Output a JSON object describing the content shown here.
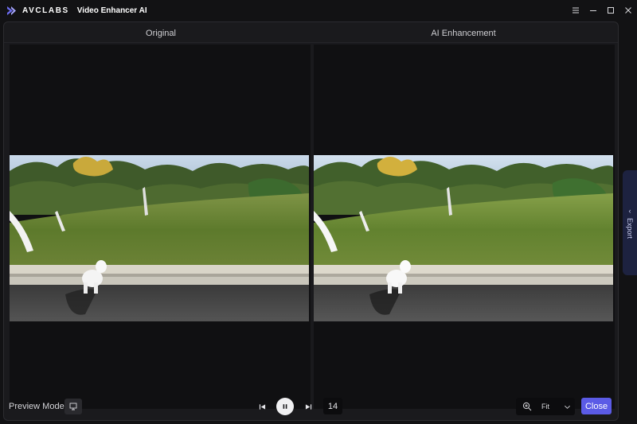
{
  "titlebar": {
    "brand": "AVCLABS",
    "app_name": "Video Enhancer AI",
    "controls": [
      "menu-icon",
      "minimize-icon",
      "maximize-icon",
      "close-icon"
    ]
  },
  "preview": {
    "left_header": "Original",
    "right_header": "AI Enhancement",
    "export_label": "Export"
  },
  "bottombar": {
    "preview_mode_label": "Preview Mode",
    "frame_number": "14",
    "zoom_value": "Fit",
    "close_label": "Close"
  },
  "colors": {
    "accent": "#5b5be6",
    "background": "#121214",
    "panel": "#1a1a1d"
  }
}
